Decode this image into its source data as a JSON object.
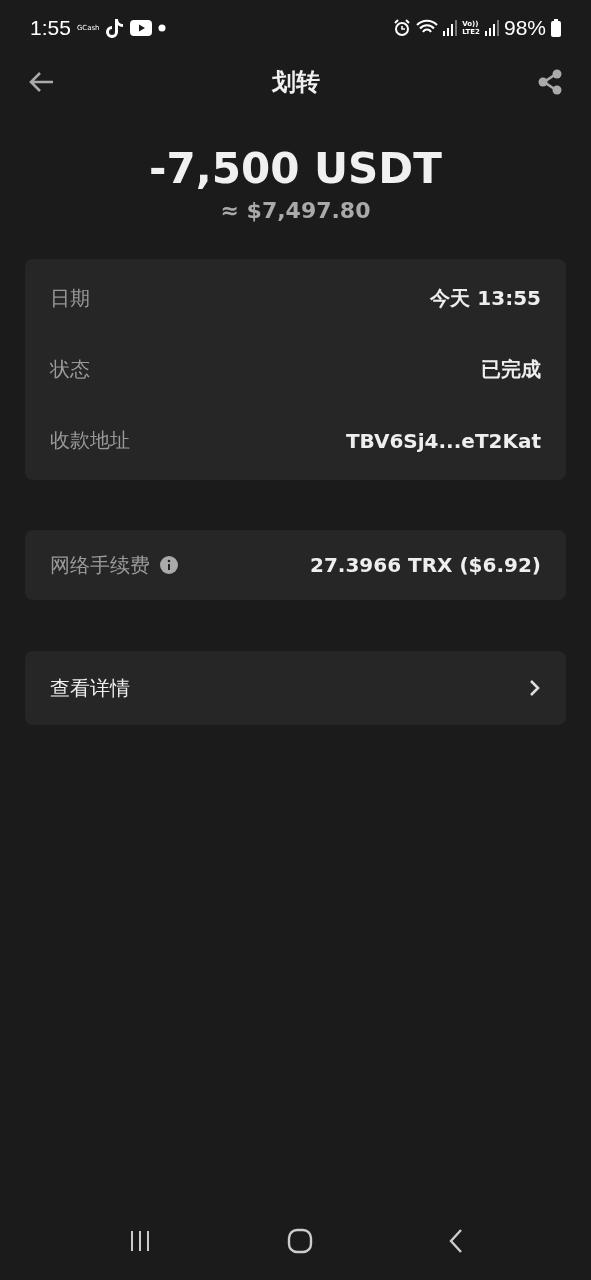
{
  "status_bar": {
    "time": "1:55",
    "app_label": "GCash",
    "network_label_top": "Vo))",
    "network_label_bottom": "LTE2",
    "battery": "98%"
  },
  "header": {
    "title": "划转"
  },
  "amount": {
    "value": "-7,500 USDT",
    "fiat": "≈ $7,497.80"
  },
  "details": [
    {
      "label": "日期",
      "value": "今天 13:55"
    },
    {
      "label": "状态",
      "value": "已完成"
    },
    {
      "label": "收款地址",
      "value": "TBV6Sj4...eT2Kat"
    }
  ],
  "fee": {
    "label": "网络手续费",
    "value": "27.3966 TRX ($6.92)"
  },
  "more": {
    "label": "查看详情"
  }
}
